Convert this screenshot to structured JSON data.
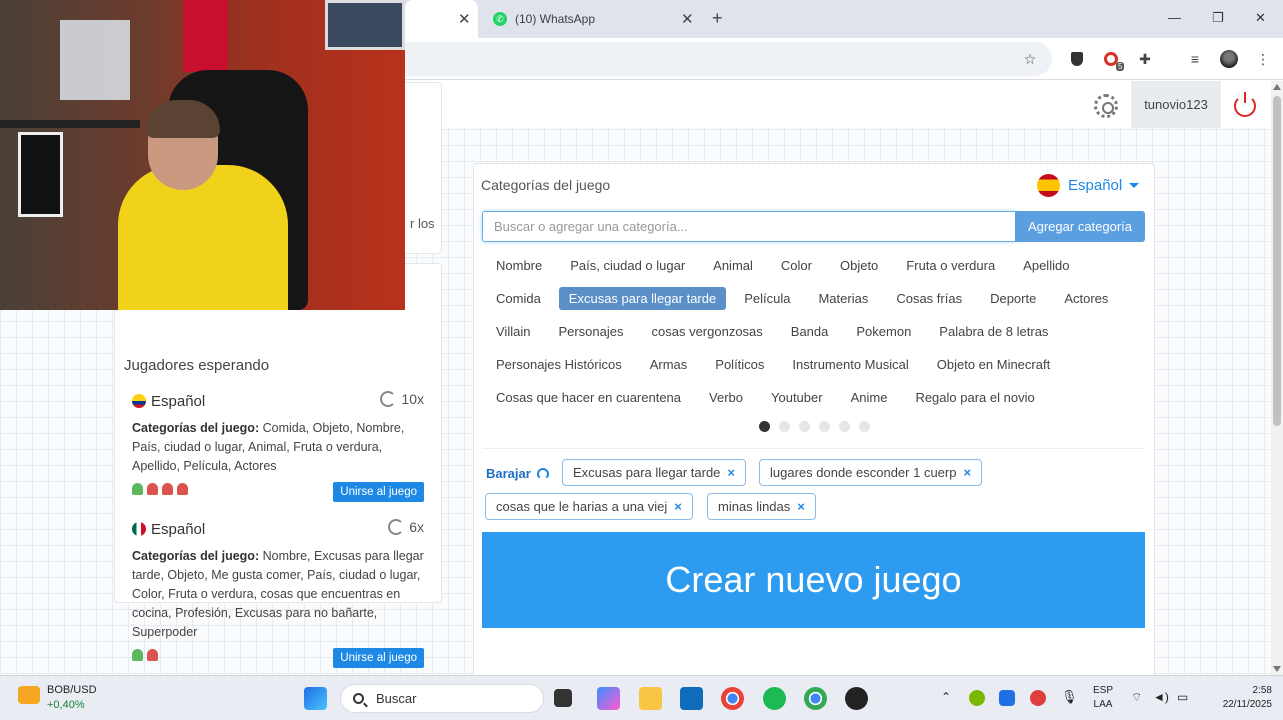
{
  "browser": {
    "tabs": [
      {
        "label": "",
        "active": true
      },
      {
        "label": "(10) WhatsApp",
        "active": false
      }
    ],
    "close_glyph": "✕",
    "newtab_glyph": "+",
    "window": {
      "min": "—",
      "max": "❐",
      "close": "✕"
    },
    "toolbar_icons": [
      "bookmark-star-icon",
      "shield-extension-icon",
      "red-extension-icon",
      "puzzle-extensions-icon",
      "media-controls-icon",
      "profile-avatar-icon",
      "kebab-menu-icon"
    ],
    "extension_badge": "5"
  },
  "header": {
    "username": "tunovio123"
  },
  "left": {
    "partial_text": "r los",
    "waiting_title": "Jugadores esperando",
    "rooms": [
      {
        "language": "Español",
        "flag": "colombia-flag-icon",
        "rounds": "10x",
        "categories_label": "Categorías del juego:",
        "categories": "Comida, Objeto, Nombre, País, ciudad o lugar, Animal, Fruta o verdura, Apellido, Película, Actores",
        "players": [
          "green",
          "red",
          "red",
          "red"
        ],
        "join_label": "Unirse al juego"
      },
      {
        "language": "Español",
        "flag": "mexico-flag-icon",
        "rounds": "6x",
        "categories_label": "Categorías del juego:",
        "categories": "Nombre, Excusas para llegar tarde, Objeto, Me gusta comer, País, ciudad o lugar, Color, Fruta o verdura, cosas que encuentras en cocina, Profesión, Excusas para no bañarte, Superpoder",
        "players": [
          "green",
          "red"
        ],
        "join_label": "Unirse al juego"
      }
    ]
  },
  "main": {
    "title": "Categorías del juego",
    "language": "Español",
    "search_placeholder": "Buscar o agregar una categoría...",
    "add_label": "Agregar categoría",
    "category_rows": [
      [
        "Nombre",
        "País, ciudad o lugar",
        "Animal",
        "Color",
        "Objeto",
        "Fruta o verdura",
        "Apellido"
      ],
      [
        "Comida",
        "Excusas para llegar tarde",
        "Película",
        "Materias",
        "Cosas frías",
        "Deporte",
        "Actores"
      ],
      [
        "Villain",
        "Personajes",
        "cosas vergonzosas",
        "Banda",
        "Pokemon",
        "Palabra de 8 letras"
      ],
      [
        "Personajes Históricos",
        "Armas",
        "Políticos",
        "Instrumento Musical",
        "Objeto en Minecraft"
      ],
      [
        "Cosas que hacer en cuarentena",
        "Verbo",
        "Youtuber",
        "Anime",
        "Regalo para el novio"
      ]
    ],
    "selected_category": "Excusas para llegar tarde",
    "pages_total": 6,
    "page_active": 1,
    "shuffle_label": "Barajar",
    "chips": [
      "Excusas para llegar tarde",
      "lugares donde esconder 1 cuerp",
      "cosas que le harias a una viej",
      "minas lindas"
    ],
    "chip_remove": "×",
    "create_label": "Crear nuevo juego"
  },
  "taskbar": {
    "stock_name": "BOB/USD",
    "stock_change": "+0,40%",
    "search_label": "Buscar",
    "lang_line1": "ESP",
    "lang_line2": "LAA",
    "time": "2:58",
    "date": "22/11/2025"
  },
  "colors": {
    "accent": "#2d9bef",
    "selected_category": "#5b8fc7",
    "logout": "#e02424"
  }
}
